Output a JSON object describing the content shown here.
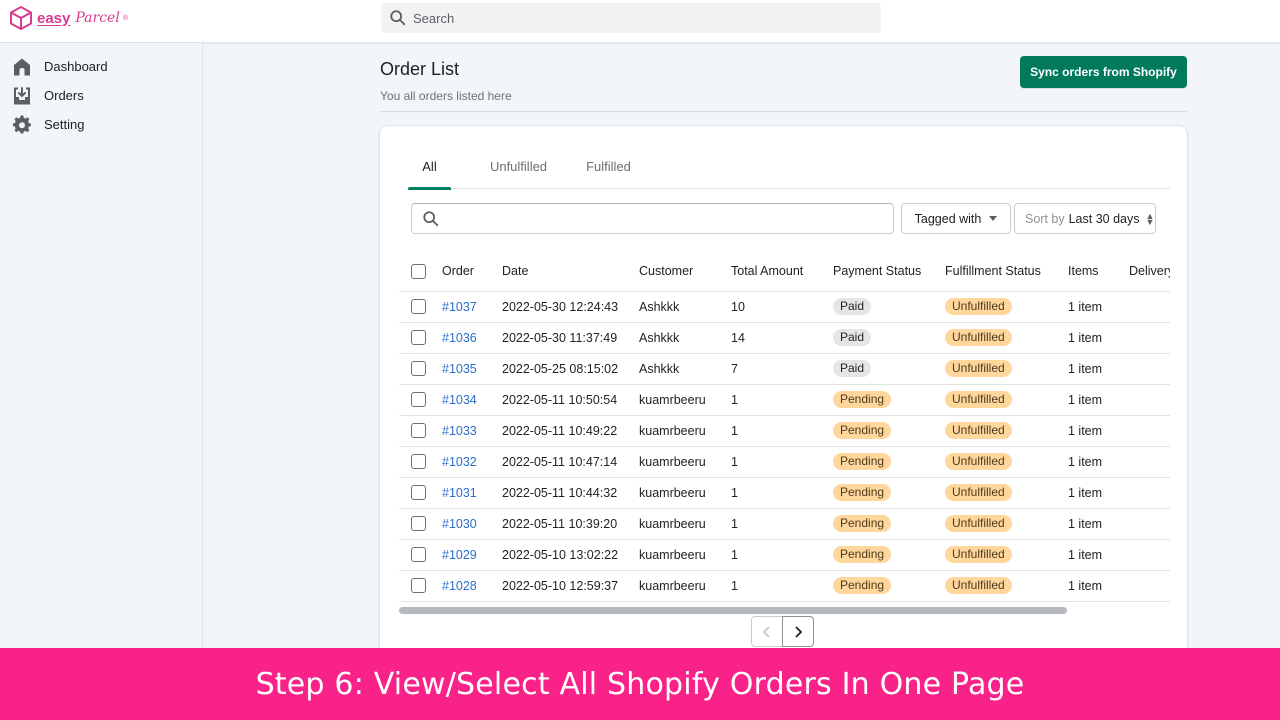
{
  "app": {
    "logo_text": "easy",
    "logo_script": "Parcel",
    "logo_mark": "®",
    "brand_color": "#d93b8e"
  },
  "topbar": {
    "search_placeholder": "Search"
  },
  "sidebar": {
    "items": [
      {
        "label": "Dashboard",
        "icon": "home-icon"
      },
      {
        "label": "Orders",
        "icon": "download-icon"
      },
      {
        "label": "Setting",
        "icon": "gear-icon"
      }
    ]
  },
  "header": {
    "title": "Order List",
    "subtitle": "You all orders listed here",
    "sync_button": "Sync orders from Shopify",
    "accent_color": "#007a5a"
  },
  "tabs": [
    {
      "label": "All",
      "active": true
    },
    {
      "label": "Unfulfilled",
      "active": false
    },
    {
      "label": "Fulfilled",
      "active": false
    }
  ],
  "filters": {
    "search_value": "",
    "tagged_with": "Tagged with",
    "sort_label": "Sort by",
    "sort_value": "Last 30 days"
  },
  "table": {
    "columns": [
      "Order",
      "Date",
      "Customer",
      "Total Amount",
      "Payment Status",
      "Fulfillment Status",
      "Items",
      "Delivery"
    ],
    "rows": [
      {
        "order": "#1037",
        "date": "2022-05-30 12:24:43",
        "customer": "Ashkkk",
        "total": "10",
        "payment": "Paid",
        "fulfillment": "Unfulfilled",
        "items": "1 item",
        "delivery": ""
      },
      {
        "order": "#1036",
        "date": "2022-05-30 11:37:49",
        "customer": "Ashkkk",
        "total": "14",
        "payment": "Paid",
        "fulfillment": "Unfulfilled",
        "items": "1 item",
        "delivery": ""
      },
      {
        "order": "#1035",
        "date": "2022-05-25 08:15:02",
        "customer": "Ashkkk",
        "total": "7",
        "payment": "Paid",
        "fulfillment": "Unfulfilled",
        "items": "1 item",
        "delivery": ""
      },
      {
        "order": "#1034",
        "date": "2022-05-11 10:50:54",
        "customer": "kuamrbeeru",
        "total": "1",
        "payment": "Pending",
        "fulfillment": "Unfulfilled",
        "items": "1 item",
        "delivery": ""
      },
      {
        "order": "#1033",
        "date": "2022-05-11 10:49:22",
        "customer": "kuamrbeeru",
        "total": "1",
        "payment": "Pending",
        "fulfillment": "Unfulfilled",
        "items": "1 item",
        "delivery": ""
      },
      {
        "order": "#1032",
        "date": "2022-05-11 10:47:14",
        "customer": "kuamrbeeru",
        "total": "1",
        "payment": "Pending",
        "fulfillment": "Unfulfilled",
        "items": "1 item",
        "delivery": ""
      },
      {
        "order": "#1031",
        "date": "2022-05-11 10:44:32",
        "customer": "kuamrbeeru",
        "total": "1",
        "payment": "Pending",
        "fulfillment": "Unfulfilled",
        "items": "1 item",
        "delivery": ""
      },
      {
        "order": "#1030",
        "date": "2022-05-11 10:39:20",
        "customer": "kuamrbeeru",
        "total": "1",
        "payment": "Pending",
        "fulfillment": "Unfulfilled",
        "items": "1 item",
        "delivery": ""
      },
      {
        "order": "#1029",
        "date": "2022-05-10 13:02:22",
        "customer": "kuamrbeeru",
        "total": "1",
        "payment": "Pending",
        "fulfillment": "Unfulfilled",
        "items": "1 item",
        "delivery": ""
      },
      {
        "order": "#1028",
        "date": "2022-05-10 12:59:37",
        "customer": "kuamrbeeru",
        "total": "1",
        "payment": "Pending",
        "fulfillment": "Unfulfilled",
        "items": "1 item",
        "delivery": ""
      }
    ]
  },
  "pagination": {
    "prev": "‹",
    "next": "›"
  },
  "banner": {
    "text": "Step 6: View/Select All Shopify Orders In One Page",
    "color": "#f92289"
  }
}
